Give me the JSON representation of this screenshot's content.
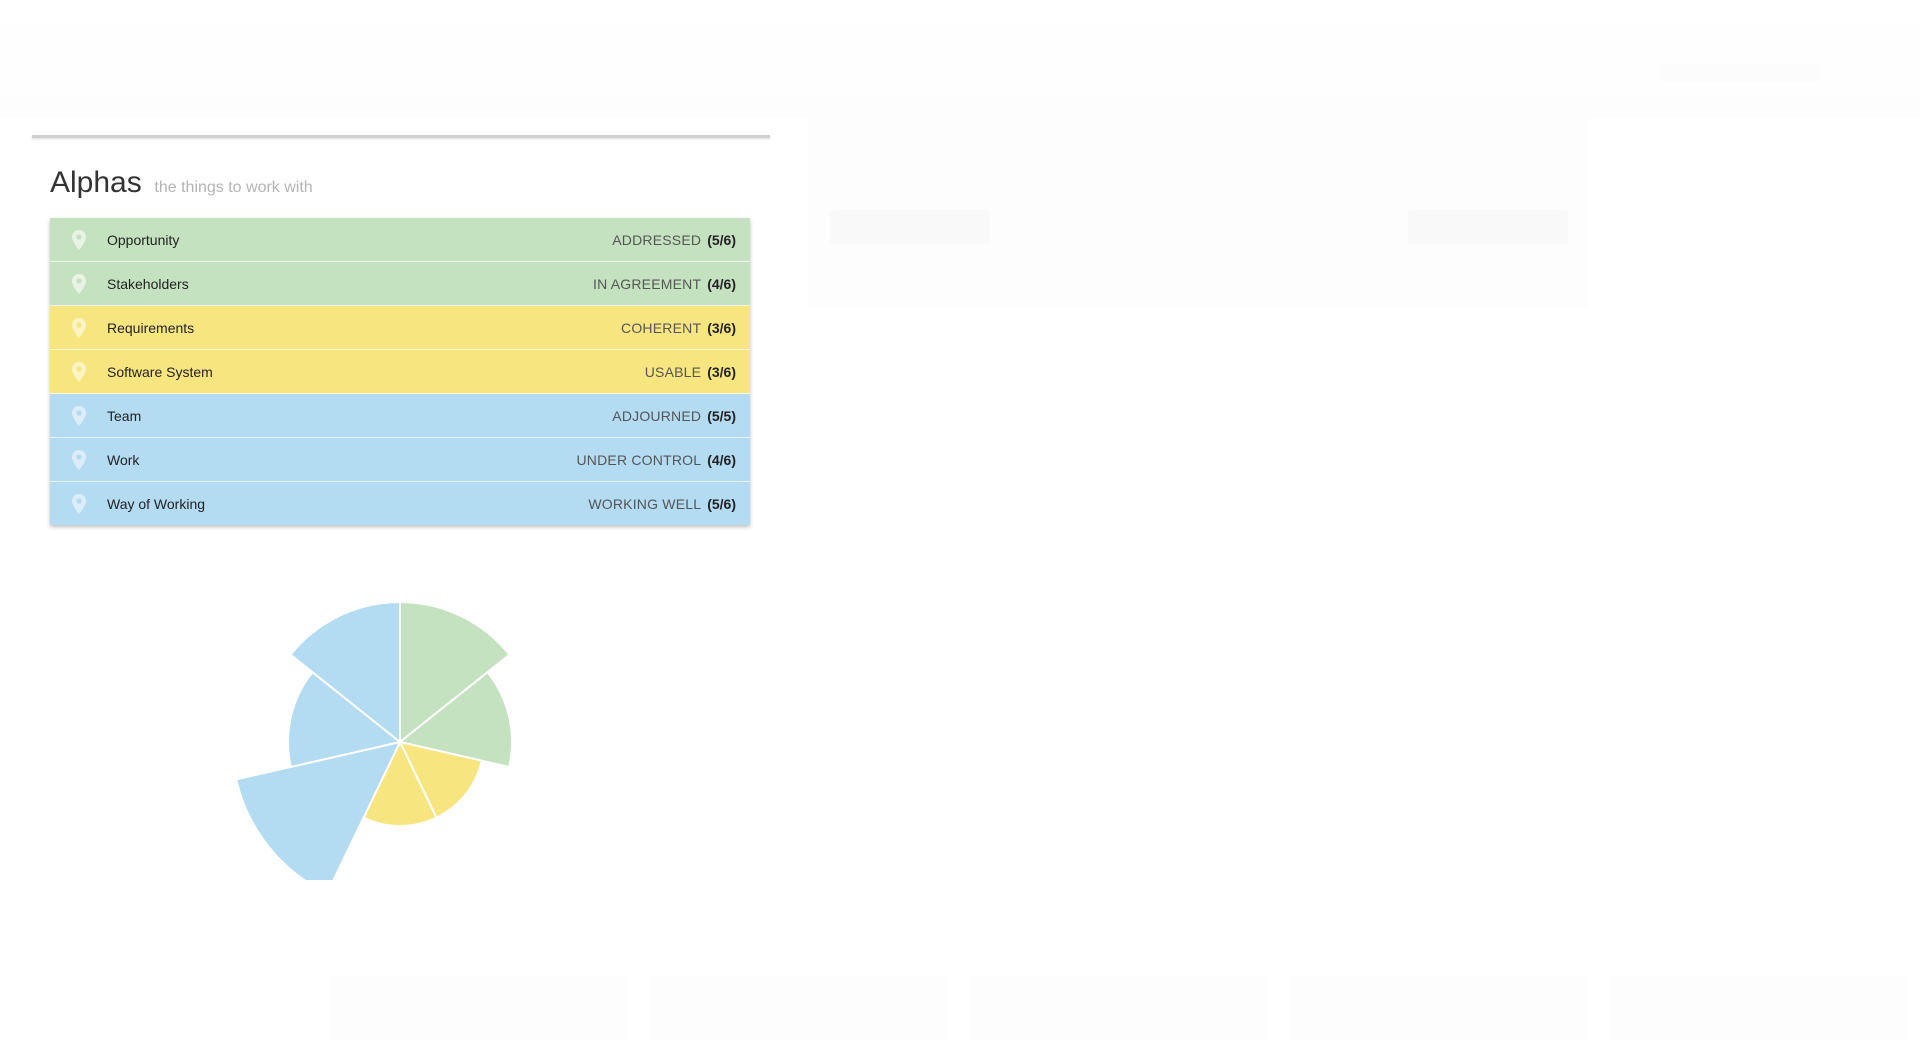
{
  "alphas": {
    "title": "Alphas",
    "subtitle": "the things to work with",
    "items": [
      {
        "name": "Opportunity",
        "state": "ADDRESSED",
        "progress": "(5/6)",
        "achieved": 5,
        "total": 6,
        "color": "#c5e2c0",
        "pin_color": "#e8f3e4"
      },
      {
        "name": "Stakeholders",
        "state": "IN AGREEMENT",
        "progress": "(4/6)",
        "achieved": 4,
        "total": 6,
        "color": "#c5e2c0",
        "pin_color": "#e8f3e4"
      },
      {
        "name": "Requirements",
        "state": "COHERENT",
        "progress": "(3/6)",
        "achieved": 3,
        "total": 6,
        "color": "#f7e680",
        "pin_color": "#fcf4c2"
      },
      {
        "name": "Software System",
        "state": "USABLE",
        "progress": "(3/6)",
        "achieved": 3,
        "total": 6,
        "color": "#f7e680",
        "pin_color": "#fcf4c2"
      },
      {
        "name": "Team",
        "state": "ADJOURNED",
        "progress": "(5/5)",
        "achieved": 5,
        "total": 5,
        "color": "#b3dbf2",
        "pin_color": "#dcedf8"
      },
      {
        "name": "Work",
        "state": "UNDER CONTROL",
        "progress": "(4/6)",
        "achieved": 4,
        "total": 6,
        "color": "#b3dbf2",
        "pin_color": "#dcedf8"
      },
      {
        "name": "Way of Working",
        "state": "WORKING WELL",
        "progress": "(5/6)",
        "achieved": 5,
        "total": 6,
        "color": "#b3dbf2",
        "pin_color": "#dcedf8"
      }
    ]
  },
  "chart_data": {
    "type": "polar-area",
    "categories": [
      "Opportunity",
      "Stakeholders",
      "Requirements",
      "Software System",
      "Team",
      "Work",
      "Way of Working"
    ],
    "values": [
      5,
      4,
      3,
      3,
      5,
      4,
      5
    ],
    "max": [
      6,
      6,
      6,
      6,
      5,
      6,
      6
    ],
    "colors": [
      "#c5e2c0",
      "#c5e2c0",
      "#f7e680",
      "#f7e680",
      "#b3dbf2",
      "#b3dbf2",
      "#b3dbf2"
    ]
  }
}
